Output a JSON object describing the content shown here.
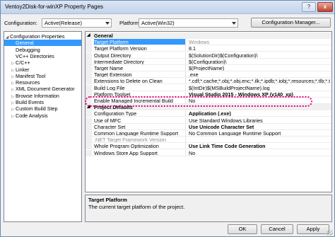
{
  "window": {
    "title": "Ventoy2Disk-for-winXP Property Pages",
    "help_label": "?",
    "close_label": "x"
  },
  "config": {
    "configuration_label": "Configuration:",
    "configuration_value": "Active(Release)",
    "platform_label": "Platform:",
    "platform_value": "Active(Win32)",
    "manager_button": "Configuration Manager..."
  },
  "tree": {
    "items": [
      {
        "label": "Configuration Properties",
        "toggle": "◢",
        "indent": 0,
        "selected": false
      },
      {
        "label": "General",
        "toggle": "",
        "indent": 1,
        "selected": true
      },
      {
        "label": "Debugging",
        "toggle": "",
        "indent": 1,
        "selected": false
      },
      {
        "label": "VC++ Directories",
        "toggle": "",
        "indent": 1,
        "selected": false
      },
      {
        "label": "C/C++",
        "toggle": "▷",
        "indent": 1,
        "selected": false
      },
      {
        "label": "Linker",
        "toggle": "▷",
        "indent": 1,
        "selected": false
      },
      {
        "label": "Manifest Tool",
        "toggle": "▷",
        "indent": 1,
        "selected": false
      },
      {
        "label": "Resources",
        "toggle": "▷",
        "indent": 1,
        "selected": false
      },
      {
        "label": "XML Document Generator",
        "toggle": "▷",
        "indent": 1,
        "selected": false
      },
      {
        "label": "Browse Information",
        "toggle": "▷",
        "indent": 1,
        "selected": false
      },
      {
        "label": "Build Events",
        "toggle": "▷",
        "indent": 1,
        "selected": false
      },
      {
        "label": "Custom Build Step",
        "toggle": "▷",
        "indent": 1,
        "selected": false
      },
      {
        "label": "Code Analysis",
        "toggle": "▷",
        "indent": 1,
        "selected": false
      }
    ]
  },
  "grid": {
    "general_category": "General",
    "general_toggle": "◢",
    "general_rows": [
      {
        "name": "Target Platform",
        "value": "Windows",
        "grey": true,
        "bold": false
      },
      {
        "name": "Target Platform Version",
        "value": "8.1",
        "grey": false,
        "bold": false
      },
      {
        "name": "Output Directory",
        "value": "$(SolutionDir)$(Configuration)\\",
        "grey": false,
        "bold": false
      },
      {
        "name": "Intermediate Directory",
        "value": "$(Configuration)\\",
        "grey": false,
        "bold": false
      },
      {
        "name": "Target Name",
        "value": "$(ProjectName)",
        "grey": false,
        "bold": false
      },
      {
        "name": "Target Extension",
        "value": ".exe",
        "grey": false,
        "bold": false
      },
      {
        "name": "Extensions to Delete on Clean",
        "value": "*.cdf;*.cache;*.obj;*.obj.enc;*.ilk;*.ipdb;*.iobj;*.resources;*.tlb;*.tli;*.t",
        "grey": false,
        "bold": false
      },
      {
        "name": "Build Log File",
        "value": "$(IntDir)$(MSBuildProjectName).log",
        "grey": false,
        "bold": false
      },
      {
        "name": "Platform Toolset",
        "value": "Visual Studio 2015 - Windows XP (v140_xp)",
        "grey": false,
        "bold": true
      },
      {
        "name": "Enable Managed Incremental Build",
        "value": "No",
        "grey": false,
        "bold": false
      }
    ],
    "defaults_category": "Project Defaults",
    "defaults_toggle": "◢",
    "defaults_rows": [
      {
        "name": "Configuration Type",
        "value": "Application (.exe)",
        "grey": false,
        "bold": true
      },
      {
        "name": "Use of MFC",
        "value": "Use Standard Windows Libraries",
        "grey": false,
        "bold": false
      },
      {
        "name": "Character Set",
        "value": "Use Unicode Character Set",
        "grey": false,
        "bold": true
      },
      {
        "name": "Common Language Runtime Support",
        "value": "No Common Language Runtime Support",
        "grey": false,
        "bold": false
      },
      {
        "name": ".NET Target Framework Version",
        "value": "",
        "grey": true,
        "bold": false
      },
      {
        "name": "Whole Program Optimization",
        "value": "Use Link Time Code Generation",
        "grey": false,
        "bold": true
      },
      {
        "name": "Windows Store App Support",
        "value": "No",
        "grey": false,
        "bold": false
      }
    ]
  },
  "description": {
    "title": "Target Platform",
    "text": "The current target platform of the project."
  },
  "buttons": {
    "ok": "OK",
    "cancel": "Cancel",
    "apply": "Apply"
  },
  "colors": {
    "selection": "#3399ff",
    "highlight_ring": "#e6007e"
  }
}
